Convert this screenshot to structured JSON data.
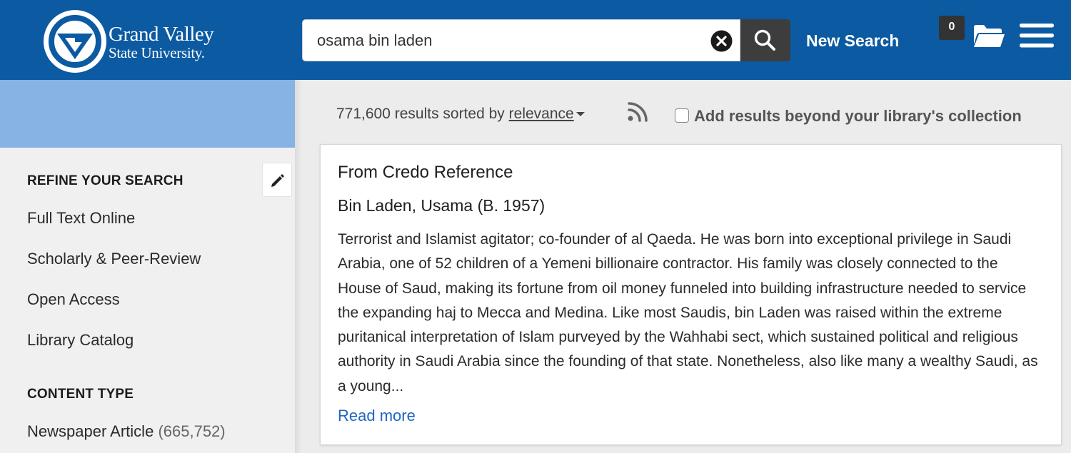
{
  "header": {
    "logo": {
      "line1": "Grand Valley",
      "line2": "State University."
    },
    "search": {
      "value": "osama bin laden",
      "placeholder": ""
    },
    "new_search_label": "New Search",
    "folder_count": "0",
    "colors": {
      "brand": "#0b5aa2",
      "search_button": "#3d3d3d"
    }
  },
  "sidebar": {
    "refine_title": "REFINE YOUR SEARCH",
    "refine_items": [
      "Full Text Online",
      "Scholarly & Peer-Review",
      "Open Access",
      "Library Catalog"
    ],
    "content_type_title": "CONTENT TYPE",
    "content_type_items": [
      {
        "label": "Newspaper Article",
        "count": "(665,752)"
      }
    ],
    "colors": {
      "band": "#86b3e3",
      "panel": "#f0f0f0"
    }
  },
  "results": {
    "count_text": "771,600 results sorted by",
    "sort_label": "relevance",
    "beyond_label": "Add results beyond your library's collection",
    "beyond_checked": false
  },
  "result_card": {
    "source": "From Credo Reference",
    "title": "Bin Laden, Usama (B. 1957)",
    "snippet": "Terrorist and Islamist agitator; co-founder of al Qaeda. He was born into exceptional privilege in Saudi Arabia, one of 52 children of a Yemeni billionaire contractor. His family was closely connected to the House of Saud, making its fortune from oil money funneled into building infrastructure needed to service the expanding haj to Mecca and Medina. Like most Saudis, bin Laden was raised within the extreme puritanical interpretation of Islam purveyed by the Wahhabi sect, which sustained political and religious authority in Saudi Arabia since the founding of that state. Nonetheless, also like many a wealthy Saudi, as a young...",
    "read_more": "Read more",
    "link_color": "#1f66c2"
  },
  "icons": [
    "gvsu-logo-icon",
    "clear-search-icon",
    "search-icon",
    "folder-icon",
    "hamburger-menu-icon",
    "pencil-icon",
    "rss-icon",
    "caret-down-icon"
  ]
}
